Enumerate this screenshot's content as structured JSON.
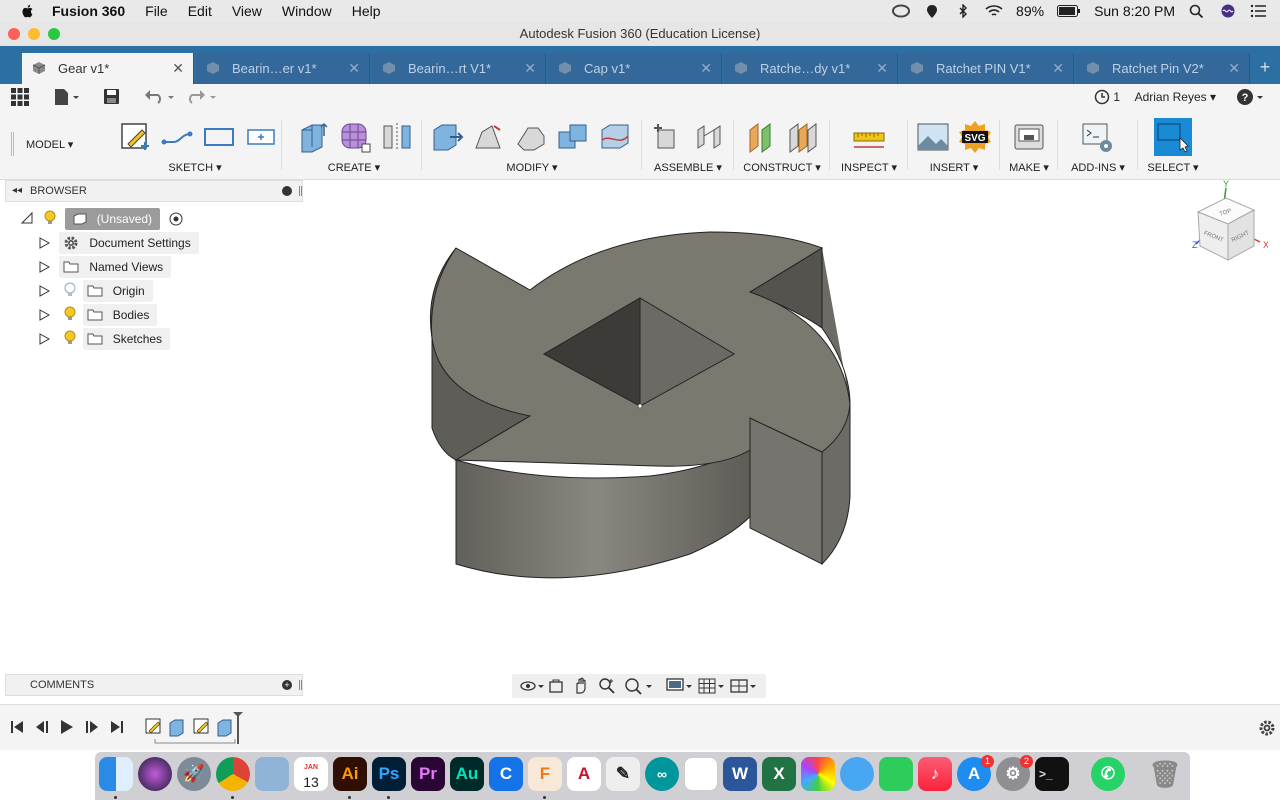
{
  "menubar": {
    "app": "Fusion 360",
    "items": [
      "File",
      "Edit",
      "View",
      "Window",
      "Help"
    ],
    "battery": "89%",
    "clock": "Sun 8:20 PM"
  },
  "window": {
    "title": "Autodesk Fusion 360 (Education License)"
  },
  "tabs": [
    {
      "label": "Gear v1*"
    },
    {
      "label": "Bearin…er v1*"
    },
    {
      "label": "Bearin…rt V1*"
    },
    {
      "label": "Cap v1*"
    },
    {
      "label": "Ratche…dy v1*"
    },
    {
      "label": "Ratchet PIN V1*"
    },
    {
      "label": "Ratchet Pin V2*"
    }
  ],
  "app_toolbar": {
    "jobs_count": "1",
    "user": "Adrian Reyes"
  },
  "ribbon": {
    "workspace": "MODEL",
    "groups": [
      "SKETCH",
      "CREATE",
      "MODIFY",
      "ASSEMBLE",
      "CONSTRUCT",
      "INSPECT",
      "INSERT",
      "MAKE",
      "ADD-INS",
      "SELECT"
    ]
  },
  "browser": {
    "title": "BROWSER",
    "root": "(Unsaved)",
    "items": [
      "Document Settings",
      "Named Views",
      "Origin",
      "Bodies",
      "Sketches"
    ]
  },
  "comments": {
    "title": "COMMENTS"
  },
  "viewcube": {
    "top": "TOP",
    "front": "FRONT",
    "right": "RIGHT",
    "x": "X",
    "y": "Y",
    "z": "Z"
  },
  "dock": {
    "calendar_month": "JAN",
    "calendar_day": "13",
    "badge_appstore": "1",
    "badge_prefs": "2",
    "apps": [
      "Finder",
      "Siri",
      "Launchpad",
      "Chrome",
      "Preview",
      "Calendar",
      "Ai",
      "Ps",
      "Pr",
      "Au",
      "Craft",
      "Fusion 360",
      "AutoCAD",
      "Inkscape",
      "Arduino",
      "Notes",
      "Word",
      "Excel",
      "Photos",
      "Messages",
      "FaceTime",
      "Music",
      "App Store",
      "System Preferences",
      "Terminal",
      "WhatsApp",
      "Trash"
    ]
  }
}
